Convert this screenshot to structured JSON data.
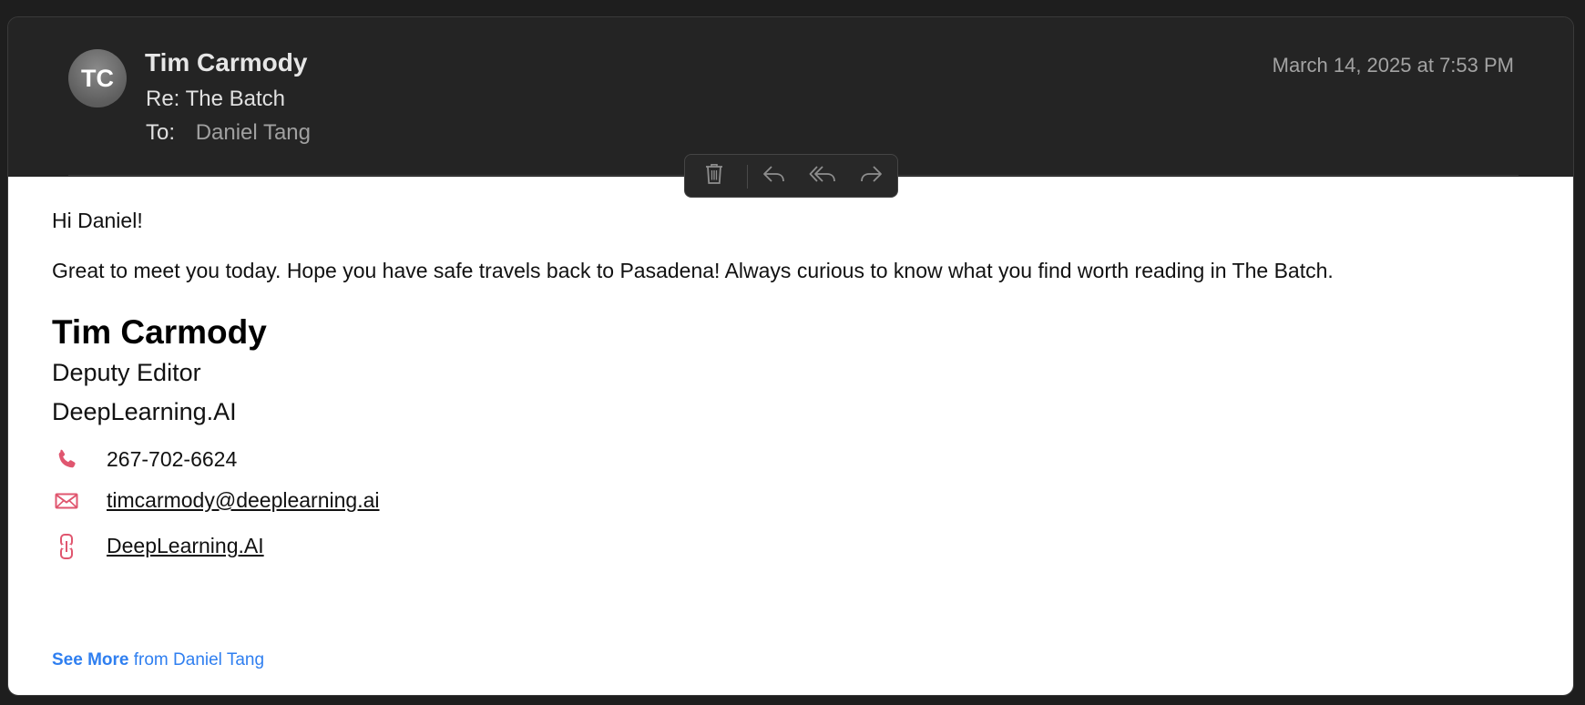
{
  "header": {
    "avatar_initials": "TC",
    "sender_name": "Tim Carmody",
    "subject": "Re: The Batch",
    "to_label": "To:",
    "to_name": "Daniel Tang",
    "date": "March 14, 2025 at 7:53 PM"
  },
  "toolbar": {
    "icons": [
      "trash-icon",
      "reply-icon",
      "reply-all-icon",
      "forward-icon"
    ]
  },
  "body": {
    "greeting": "Hi Daniel!",
    "message": "Great to meet you today. Hope you have safe travels back to Pasadena! Always curious to know what you find worth reading in The Batch.",
    "signature": {
      "name": "Tim Carmody",
      "title": "Deputy Editor",
      "company": "DeepLearning.AI",
      "phone": "267-702-6624",
      "email": "timcarmody@deeplearning.ai",
      "website": "DeepLearning.AI"
    },
    "see_more_bold": "See More",
    "see_more_rest": " from Daniel Tang"
  },
  "colors": {
    "header_bg": "#242424",
    "accent_blue": "#2f7ff0",
    "icon_pink": "#e0566f"
  }
}
